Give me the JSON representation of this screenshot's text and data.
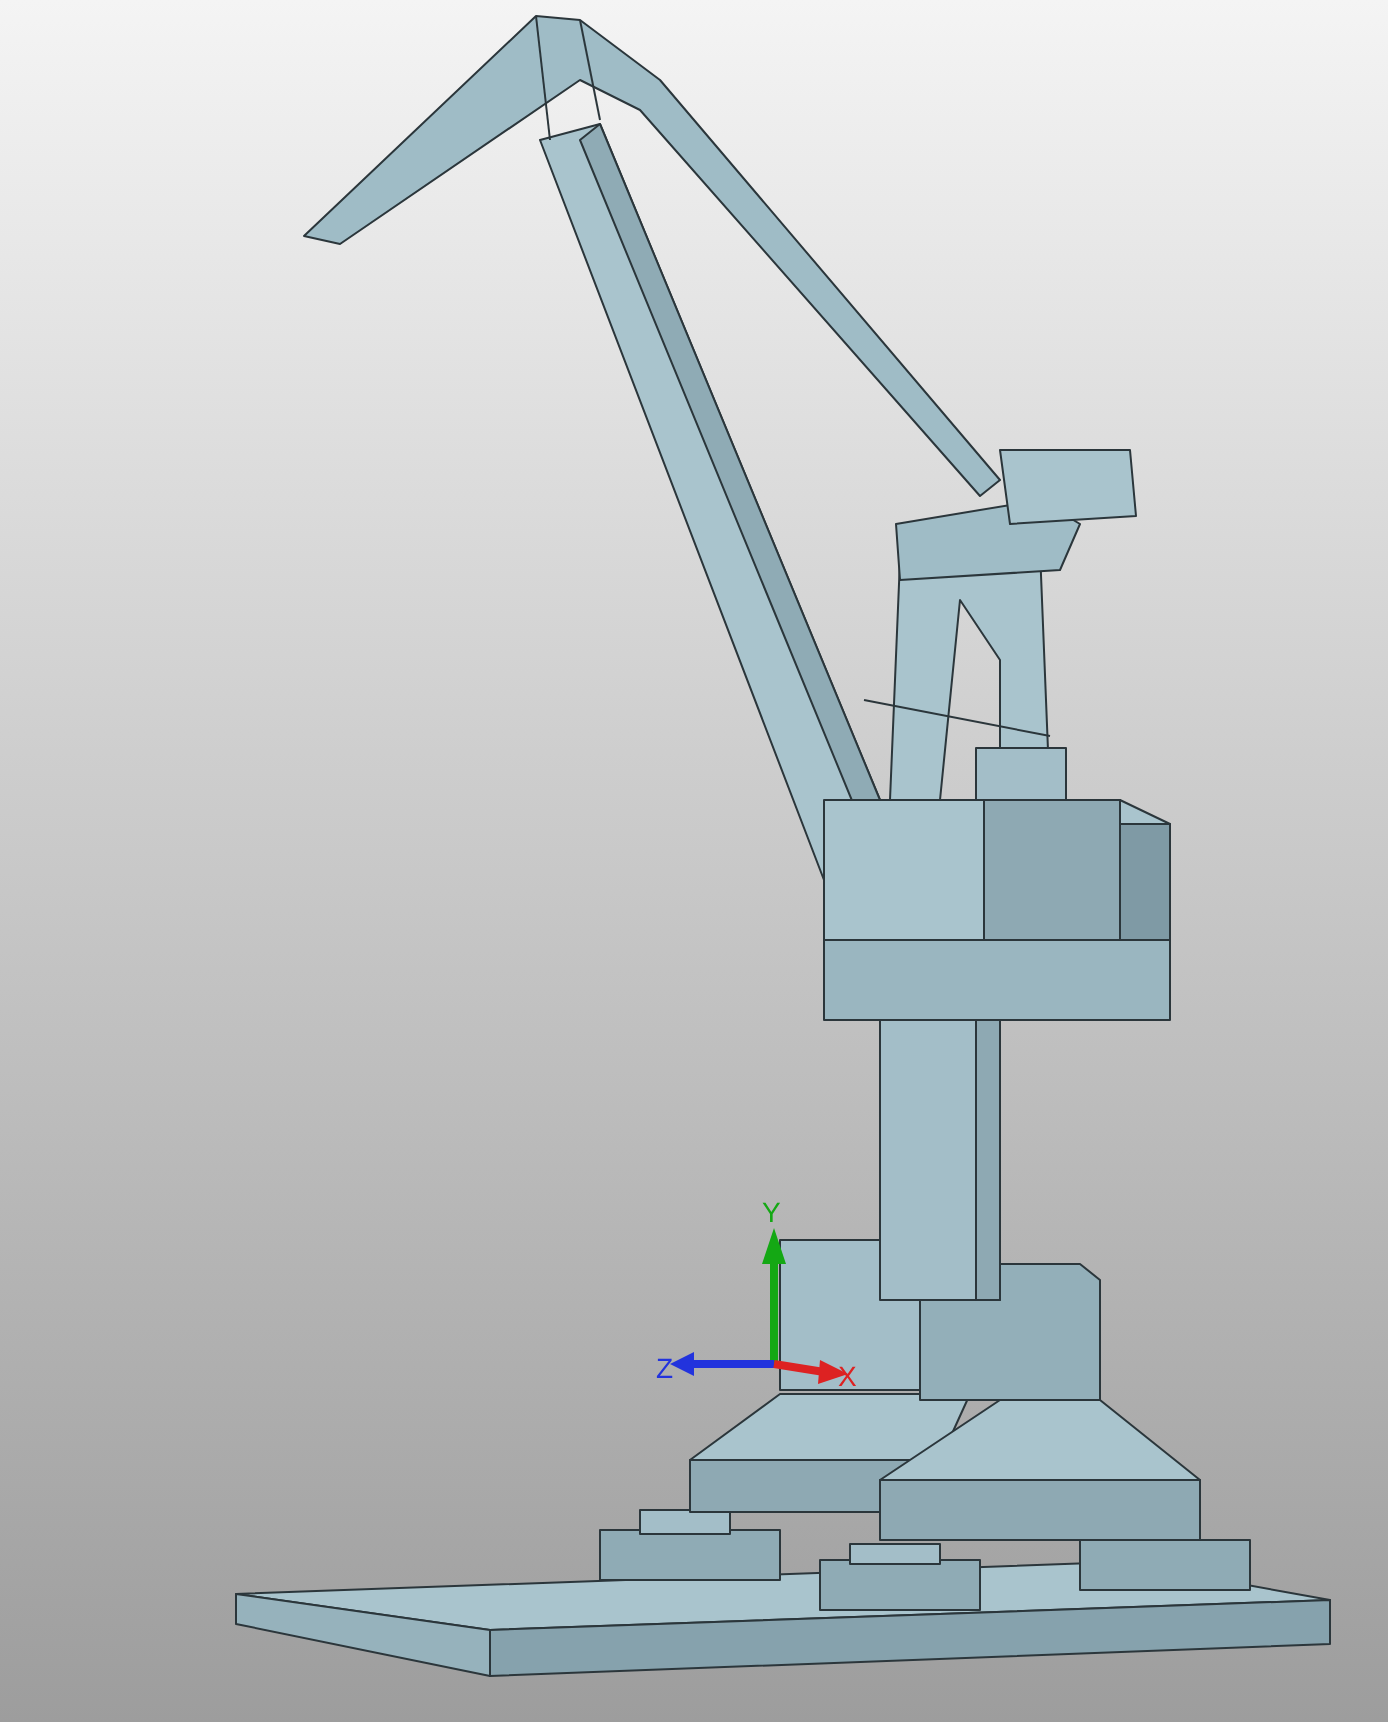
{
  "viewport": {
    "axes": [
      {
        "label": "Y",
        "color": "#14a814"
      },
      {
        "label": "Z",
        "color": "#2233dd"
      },
      {
        "label": "X",
        "color": "#dd2222"
      }
    ]
  }
}
